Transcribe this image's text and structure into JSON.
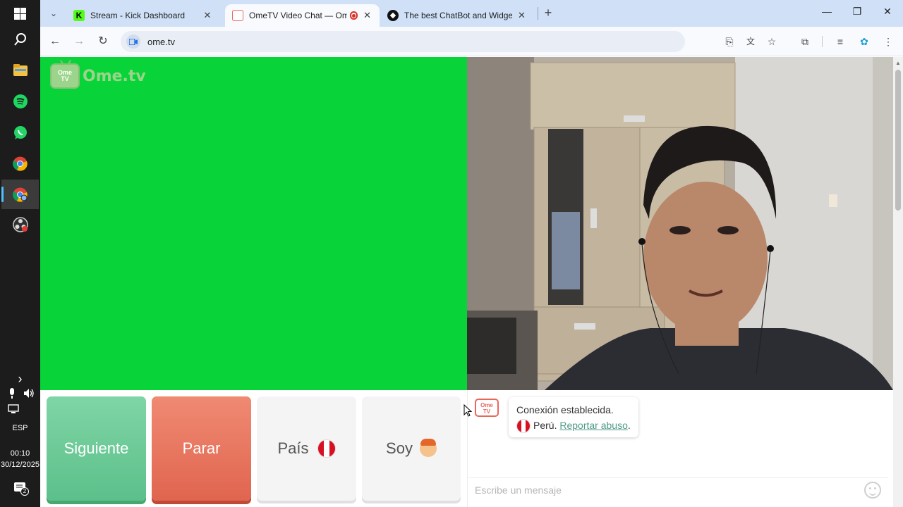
{
  "taskbar": {
    "icons": [
      "windows-start-icon",
      "search-icon",
      "file-explorer-icon",
      "spotify-icon",
      "whatsapp-icon",
      "chrome-icon",
      "chrome-profile-icon",
      "obs-icon"
    ],
    "tray_chevron": "›",
    "language": "ESP",
    "time": "00:10",
    "date": "30/12/2025",
    "notification_count": "2"
  },
  "browser": {
    "tabs": [
      {
        "title": "Stream - Kick Dashboard",
        "favicon": "kick-icon",
        "active": false
      },
      {
        "title": "OmeTV Video Chat — Ome",
        "favicon": "ometv-icon",
        "active": true,
        "recording": true
      },
      {
        "title": "The best ChatBot and Widgets",
        "favicon": "streamelements-icon",
        "active": false
      }
    ],
    "new_tab": "+",
    "url": "ome.tv",
    "window_controls": {
      "minimize": "—",
      "restore": "❐",
      "close": "✕"
    }
  },
  "page": {
    "logo_tv_line1": "Ome",
    "logo_tv_line2": "TV",
    "logo_text": "Ome.tv",
    "buttons": {
      "next": "Siguiente",
      "stop": "Parar",
      "country": "País",
      "gender": "Soy"
    },
    "chat": {
      "icon_line1": "Ome",
      "icon_line2": "TV",
      "status": "Conexión establecida.",
      "country": "Perú.",
      "report_link": "Reportar abuso",
      "report_suffix": ".",
      "input_placeholder": "Escribe un mensaje"
    }
  },
  "colors": {
    "stranger_video_bg": "#08d43a",
    "next_button": "#5cc08b",
    "stop_button": "#e0654f",
    "link": "#4e9a86"
  }
}
